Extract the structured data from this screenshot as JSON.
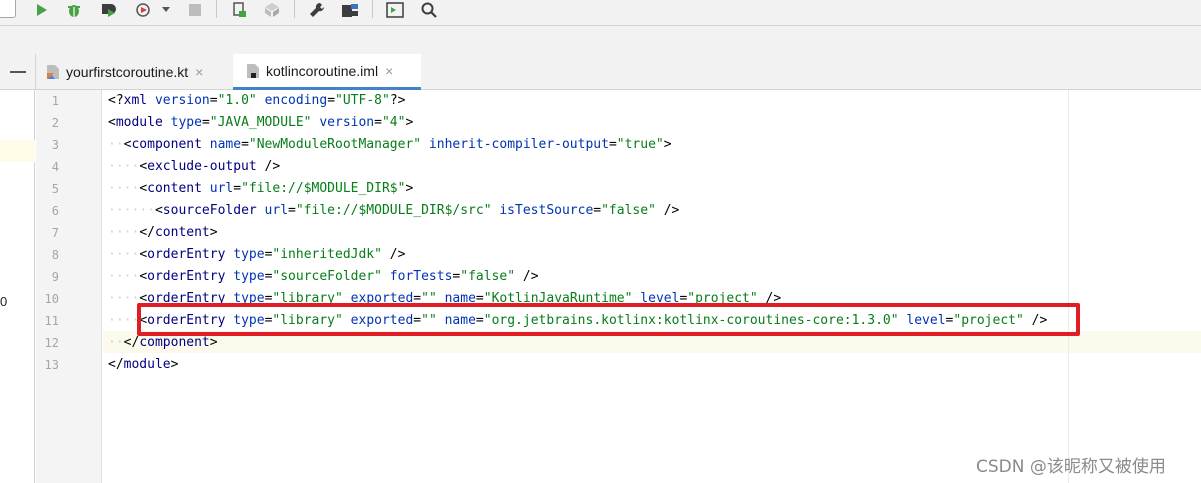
{
  "toolbar": {
    "icons": [
      "run-icon",
      "debug-icon",
      "run-with-coverage-icon",
      "profile-icon",
      "stop-icon",
      "build-icon",
      "build-artifact-icon",
      "settings-wrench-icon",
      "project-structure-icon",
      "terminal-icon",
      "search-icon"
    ]
  },
  "tabs": [
    {
      "label": "yourfirstcoroutine.kt",
      "active": false,
      "close": "×"
    },
    {
      "label": "kotlincoroutine.iml",
      "active": true,
      "close": "×"
    }
  ],
  "left_panel": {
    "fragment": "0"
  },
  "editor": {
    "line_numbers": [
      "1",
      "2",
      "3",
      "4",
      "5",
      "6",
      "7",
      "8",
      "9",
      "10",
      "11",
      "12",
      "13"
    ],
    "current_line": "12",
    "highlighted_line": "11"
  },
  "watermark": "CSDN @该昵称又被使用",
  "colors": {
    "highlight_box": "#e01d24",
    "tab_active_underline": "#4083c9",
    "xml_tag": "#000080",
    "xml_attr_name": "#0033b3",
    "xml_attr_value": "#067d17"
  }
}
